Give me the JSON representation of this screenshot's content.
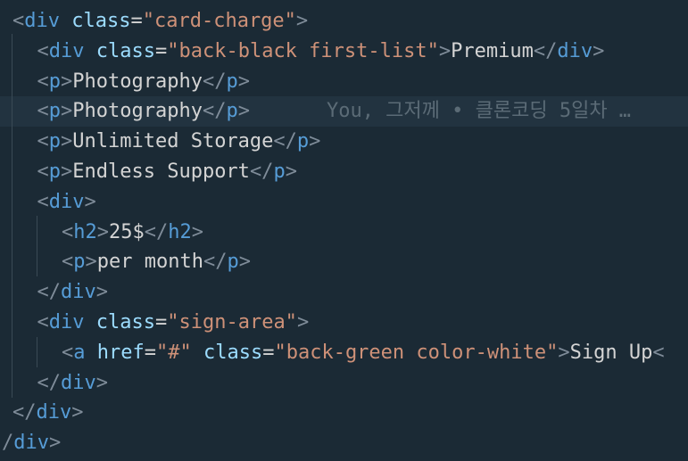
{
  "lines": [
    {
      "indent": "",
      "parts": [
        {
          "t": "<",
          "c": "bracket"
        },
        {
          "t": "div",
          "c": "tag"
        },
        {
          "t": " ",
          "c": "text"
        },
        {
          "t": "class",
          "c": "attr"
        },
        {
          "t": "=",
          "c": "eq"
        },
        {
          "t": "\"card-charge\"",
          "c": "str"
        },
        {
          "t": ">",
          "c": "bracket"
        }
      ]
    },
    {
      "indent": "  ",
      "parts": [
        {
          "t": "<",
          "c": "bracket"
        },
        {
          "t": "div",
          "c": "tag"
        },
        {
          "t": " ",
          "c": "text"
        },
        {
          "t": "class",
          "c": "attr"
        },
        {
          "t": "=",
          "c": "eq"
        },
        {
          "t": "\"back-black first-list\"",
          "c": "str"
        },
        {
          "t": ">",
          "c": "bracket"
        },
        {
          "t": "Premium",
          "c": "text"
        },
        {
          "t": "</",
          "c": "bracket"
        },
        {
          "t": "div",
          "c": "tag"
        },
        {
          "t": ">",
          "c": "bracket"
        }
      ]
    },
    {
      "indent": "  ",
      "parts": [
        {
          "t": "<",
          "c": "bracket"
        },
        {
          "t": "p",
          "c": "tag"
        },
        {
          "t": ">",
          "c": "bracket"
        },
        {
          "t": "Photography",
          "c": "text"
        },
        {
          "t": "</",
          "c": "bracket"
        },
        {
          "t": "p",
          "c": "tag"
        },
        {
          "t": ">",
          "c": "bracket"
        }
      ]
    },
    {
      "indent": "  ",
      "current": true,
      "blame": "You, 그저께 • 클론코딩 5일차 …",
      "parts": [
        {
          "t": "<",
          "c": "bracket"
        },
        {
          "t": "p",
          "c": "tag"
        },
        {
          "t": ">",
          "c": "bracket"
        },
        {
          "t": "Photography",
          "c": "text"
        },
        {
          "t": "</",
          "c": "bracket"
        },
        {
          "t": "p",
          "c": "tag"
        },
        {
          "t": ">",
          "c": "bracket"
        }
      ]
    },
    {
      "indent": "  ",
      "parts": [
        {
          "t": "<",
          "c": "bracket"
        },
        {
          "t": "p",
          "c": "tag"
        },
        {
          "t": ">",
          "c": "bracket"
        },
        {
          "t": "Unlimited Storage",
          "c": "text"
        },
        {
          "t": "</",
          "c": "bracket"
        },
        {
          "t": "p",
          "c": "tag"
        },
        {
          "t": ">",
          "c": "bracket"
        }
      ]
    },
    {
      "indent": "  ",
      "parts": [
        {
          "t": "<",
          "c": "bracket"
        },
        {
          "t": "p",
          "c": "tag"
        },
        {
          "t": ">",
          "c": "bracket"
        },
        {
          "t": "Endless Support",
          "c": "text"
        },
        {
          "t": "</",
          "c": "bracket"
        },
        {
          "t": "p",
          "c": "tag"
        },
        {
          "t": ">",
          "c": "bracket"
        }
      ]
    },
    {
      "indent": "  ",
      "parts": [
        {
          "t": "<",
          "c": "bracket"
        },
        {
          "t": "div",
          "c": "tag"
        },
        {
          "t": ">",
          "c": "bracket"
        }
      ]
    },
    {
      "indent": "    ",
      "parts": [
        {
          "t": "<",
          "c": "bracket"
        },
        {
          "t": "h2",
          "c": "tag"
        },
        {
          "t": ">",
          "c": "bracket"
        },
        {
          "t": "25$",
          "c": "text"
        },
        {
          "t": "</",
          "c": "bracket"
        },
        {
          "t": "h2",
          "c": "tag"
        },
        {
          "t": ">",
          "c": "bracket"
        }
      ]
    },
    {
      "indent": "    ",
      "parts": [
        {
          "t": "<",
          "c": "bracket"
        },
        {
          "t": "p",
          "c": "tag"
        },
        {
          "t": ">",
          "c": "bracket"
        },
        {
          "t": "per month",
          "c": "text"
        },
        {
          "t": "</",
          "c": "bracket"
        },
        {
          "t": "p",
          "c": "tag"
        },
        {
          "t": ">",
          "c": "bracket"
        }
      ]
    },
    {
      "indent": "  ",
      "parts": [
        {
          "t": "</",
          "c": "bracket"
        },
        {
          "t": "div",
          "c": "tag"
        },
        {
          "t": ">",
          "c": "bracket"
        }
      ]
    },
    {
      "indent": "  ",
      "parts": [
        {
          "t": "<",
          "c": "bracket"
        },
        {
          "t": "div",
          "c": "tag"
        },
        {
          "t": " ",
          "c": "text"
        },
        {
          "t": "class",
          "c": "attr"
        },
        {
          "t": "=",
          "c": "eq"
        },
        {
          "t": "\"sign-area\"",
          "c": "str"
        },
        {
          "t": ">",
          "c": "bracket"
        }
      ]
    },
    {
      "indent": "    ",
      "parts": [
        {
          "t": "<",
          "c": "bracket"
        },
        {
          "t": "a",
          "c": "tag"
        },
        {
          "t": " ",
          "c": "text"
        },
        {
          "t": "href",
          "c": "attr"
        },
        {
          "t": "=",
          "c": "eq"
        },
        {
          "t": "\"#\"",
          "c": "str"
        },
        {
          "t": " ",
          "c": "text"
        },
        {
          "t": "class",
          "c": "attr"
        },
        {
          "t": "=",
          "c": "eq"
        },
        {
          "t": "\"back-green color-white\"",
          "c": "str"
        },
        {
          "t": ">",
          "c": "bracket"
        },
        {
          "t": "Sign Up",
          "c": "text"
        },
        {
          "t": "<",
          "c": "bracket"
        }
      ]
    },
    {
      "indent": "  ",
      "parts": [
        {
          "t": "</",
          "c": "bracket"
        },
        {
          "t": "div",
          "c": "tag"
        },
        {
          "t": ">",
          "c": "bracket"
        }
      ]
    },
    {
      "indent": "",
      "parts": [
        {
          "t": "</",
          "c": "bracket"
        },
        {
          "t": "div",
          "c": "tag"
        },
        {
          "t": ">",
          "c": "bracket"
        }
      ]
    },
    {
      "indent": "",
      "outdent": true,
      "parts": [
        {
          "t": "/",
          "c": "bracket"
        },
        {
          "t": "div",
          "c": "tag"
        },
        {
          "t": ">",
          "c": "bracket"
        }
      ]
    }
  ],
  "colors": {
    "background": "#1b2a35",
    "current_line": "#223340",
    "bracket": "#7f8c99",
    "tag": "#569cd6",
    "attribute": "#9cdcfe",
    "string": "#ce9178",
    "text": "#d4d4d4",
    "blame": "#5b6b76"
  }
}
